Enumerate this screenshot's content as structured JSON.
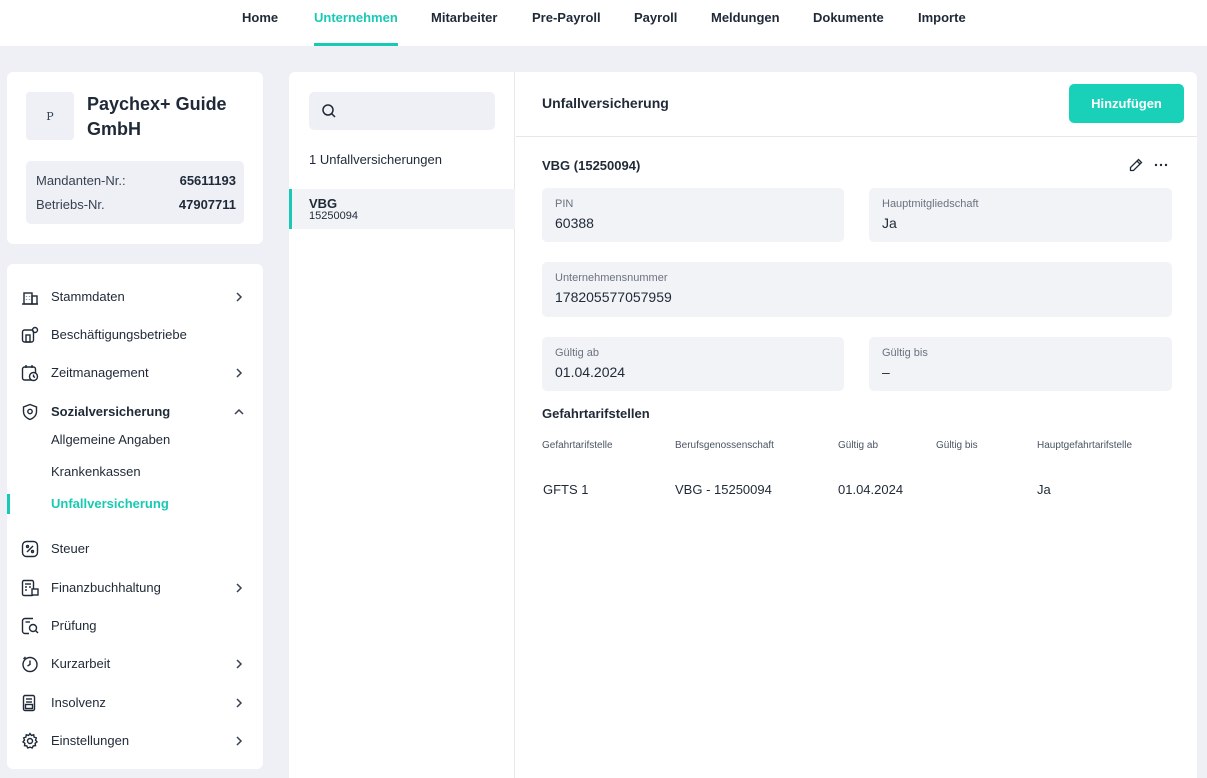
{
  "nav": {
    "items": [
      "Home",
      "Unternehmen",
      "Mitarbeiter",
      "Pre-Payroll",
      "Payroll",
      "Meldungen",
      "Dokumente",
      "Importe"
    ],
    "active": "Unternehmen"
  },
  "company": {
    "logo_letter": "P",
    "name": "Paychex+ Guide GmbH",
    "mandanten_label": "Mandanten-Nr.:",
    "mandanten_value": "65611193",
    "betriebs_label": "Betriebs-Nr.",
    "betriebs_value": "47907711"
  },
  "sidebar": {
    "items": [
      {
        "label": "Stammdaten",
        "icon": "building-icon",
        "chevron": "right"
      },
      {
        "label": "Beschäftigungsbetriebe",
        "icon": "office-settings-icon"
      },
      {
        "label": "Zeitmanagement",
        "icon": "calendar-clock-icon",
        "chevron": "right"
      },
      {
        "label": "Sozialversicherung",
        "icon": "shield-icon",
        "chevron": "up"
      },
      {
        "label": "Steuer",
        "icon": "tax-icon"
      },
      {
        "label": "Finanzbuchhaltung",
        "icon": "ledger-icon",
        "chevron": "right"
      },
      {
        "label": "Prüfung",
        "icon": "audit-icon"
      },
      {
        "label": "Kurzarbeit",
        "icon": "clock-icon",
        "chevron": "right"
      },
      {
        "label": "Insolvenz",
        "icon": "insolvency-icon",
        "chevron": "right"
      },
      {
        "label": "Einstellungen",
        "icon": "gear-icon",
        "chevron": "right"
      }
    ],
    "subitems": [
      "Allgemeine Angaben",
      "Krankenkassen",
      "Unfallversicherung"
    ],
    "active_subitem": "Unfallversicherung"
  },
  "list": {
    "search_placeholder": "",
    "count_text": "1 Unfallversicherungen",
    "entries": [
      {
        "title": "VBG",
        "subtitle": "15250094"
      }
    ]
  },
  "detail": {
    "title": "Unfallversicherung",
    "add_label": "Hinzufügen",
    "record_title": "VBG (15250094)",
    "fields": {
      "pin": {
        "label": "PIN",
        "value": "60388"
      },
      "hauptmitgliedschaft": {
        "label": "Hauptmitgliedschaft",
        "value": "Ja"
      },
      "unternehmensnummer": {
        "label": "Unternehmensnummer",
        "value": "178205577057959"
      },
      "gueltig_ab": {
        "label": "Gültig ab",
        "value": "01.04.2024"
      },
      "gueltig_bis": {
        "label": "Gültig bis",
        "value": "–"
      }
    },
    "table": {
      "title": "Gefahrtarifstellen",
      "headers": [
        "Gefahrtarifstelle",
        "Berufsgenossenschaft",
        "Gültig ab",
        "Gültig bis",
        "Hauptgefahrtarifstelle"
      ],
      "rows": [
        [
          "GFTS 1",
          "VBG - 15250094",
          "01.04.2024",
          "",
          "Ja"
        ]
      ]
    }
  },
  "colors": {
    "accent": "#18c9b4",
    "button": "#18d1b8",
    "background": "#eef0f6",
    "field": "#f1f3f7"
  }
}
